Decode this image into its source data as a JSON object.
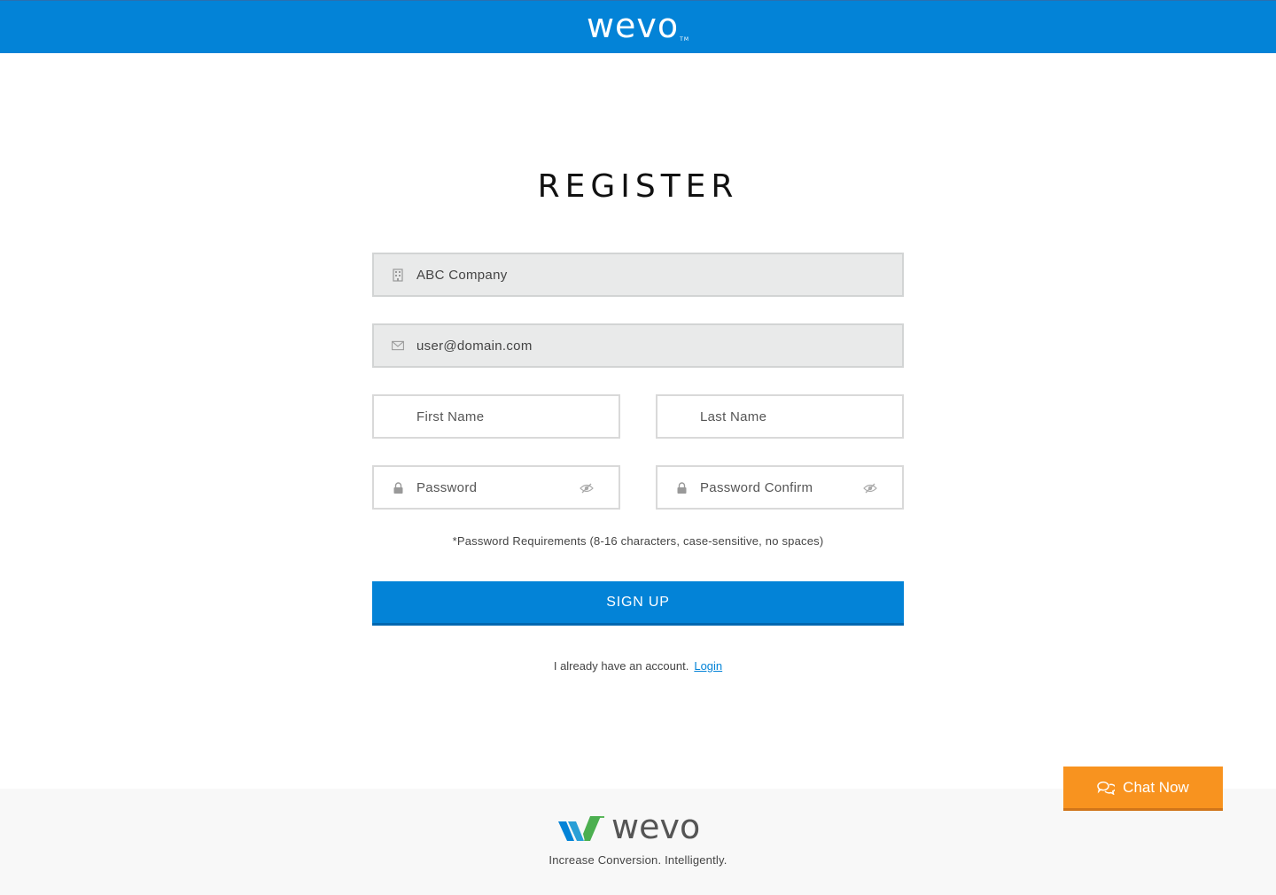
{
  "header": {
    "logo_text": "wevo",
    "logo_tm": "TM"
  },
  "page": {
    "title": "REGISTER"
  },
  "form": {
    "company": {
      "value": "ABC Company",
      "icon": "building-icon"
    },
    "email": {
      "value": "user@domain.com",
      "icon": "envelope-icon"
    },
    "first_name": {
      "placeholder": "First Name"
    },
    "last_name": {
      "placeholder": "Last Name"
    },
    "password": {
      "placeholder": "Password",
      "icon": "lock-icon",
      "toggle_icon": "eye-slash-icon"
    },
    "password_confirm": {
      "placeholder": "Password Confirm",
      "icon": "lock-icon",
      "toggle_icon": "eye-slash-icon"
    },
    "requirements": "*Password Requirements (8-16 characters, case-sensitive, no spaces)",
    "submit_label": "SIGN UP"
  },
  "account": {
    "text": "I already have an account.",
    "login_label": "Login"
  },
  "footer": {
    "logo_text": "wevo",
    "tagline": "Increase Conversion. Intelligently."
  },
  "chat": {
    "label": "Chat Now",
    "icon": "chat-bubbles-icon"
  },
  "colors": {
    "primary": "#0383d7",
    "chat": "#f8931f",
    "field_filled_bg": "#e9eaea"
  }
}
